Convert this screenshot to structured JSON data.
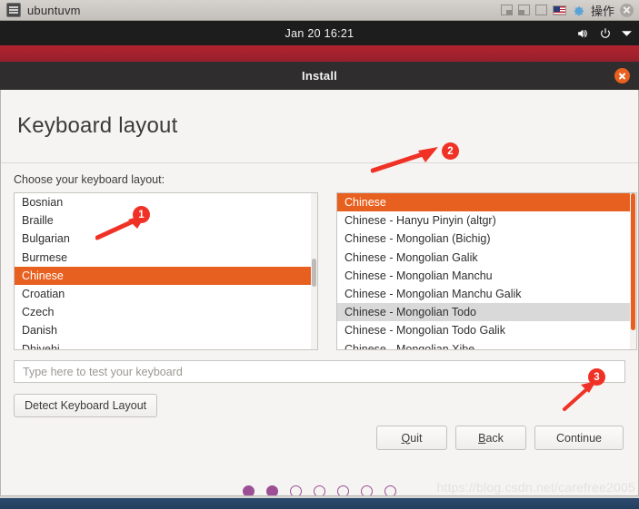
{
  "vm_window": {
    "title": "ubuntuvm",
    "app_icon": "terminal-icon",
    "controls": {
      "minimize": "minimize-icon",
      "restore": "restore-icon",
      "maximize": "maximize-icon",
      "keyboard_flag": "us-flag-icon",
      "settings": "gear-icon",
      "action_label": "操作",
      "close": "close-icon"
    }
  },
  "ubuntu_panel": {
    "clock": "Jan 20  16:21",
    "volume_icon": "volume-icon",
    "power_icon": "power-icon",
    "menu_icon": "chevron-down-icon"
  },
  "dialog": {
    "title": "Install",
    "close_icon": "close-icon"
  },
  "page": {
    "heading": "Keyboard layout",
    "prompt": "Choose your keyboard layout:"
  },
  "left_list": {
    "name": "keyboard-language-list",
    "items": [
      {
        "label": "Bosnian",
        "state": "normal"
      },
      {
        "label": "Braille",
        "state": "normal"
      },
      {
        "label": "Bulgarian",
        "state": "normal"
      },
      {
        "label": "Burmese",
        "state": "normal"
      },
      {
        "label": "Chinese",
        "state": "selected"
      },
      {
        "label": "Croatian",
        "state": "normal"
      },
      {
        "label": "Czech",
        "state": "normal"
      },
      {
        "label": "Danish",
        "state": "normal"
      },
      {
        "label": "Dhivehi",
        "state": "normal"
      }
    ],
    "scroll_thumb_top_pct": 42,
    "scroll_thumb_height_pct": 18
  },
  "right_list": {
    "name": "keyboard-variant-list",
    "items": [
      {
        "label": "Chinese",
        "state": "selected"
      },
      {
        "label": "Chinese - Hanyu Pinyin (altgr)",
        "state": "normal"
      },
      {
        "label": "Chinese - Mongolian (Bichig)",
        "state": "normal"
      },
      {
        "label": "Chinese - Mongolian Galik",
        "state": "normal"
      },
      {
        "label": "Chinese - Mongolian Manchu",
        "state": "normal"
      },
      {
        "label": "Chinese - Mongolian Manchu Galik",
        "state": "normal"
      },
      {
        "label": "Chinese - Mongolian Todo",
        "state": "hover"
      },
      {
        "label": "Chinese - Mongolian Todo Galik",
        "state": "normal"
      },
      {
        "label": "Chinese - Mongolian Xibe",
        "state": "normal"
      }
    ],
    "scroll_thumb_top_pct": 0,
    "scroll_thumb_height_pct": 88
  },
  "test_field": {
    "placeholder": "Type here to test your keyboard",
    "value": ""
  },
  "buttons": {
    "detect": "Detect Keyboard Layout",
    "quit": "Quit",
    "quit_mnemonic": "Q",
    "quit_rest": "uit",
    "back": "Back",
    "back_mnemonic": "B",
    "back_rest": "ack",
    "continue": "Continue"
  },
  "progress_dots": {
    "total": 7,
    "filled": 2,
    "color": "#9c4f95"
  },
  "annotations": [
    {
      "id": "1",
      "label": "1",
      "target": "left-list-chinese"
    },
    {
      "id": "2",
      "label": "2",
      "target": "right-list-chinese"
    },
    {
      "id": "3",
      "label": "3",
      "target": "continue-button"
    }
  ],
  "watermark": "https://blog.csdn.net/carefree2005",
  "colors": {
    "ubuntu_orange": "#e8601f",
    "panel_dark": "#1d1d1d",
    "dialog_header": "#2f2d2d",
    "desktop_maroon": "#a7212d",
    "annotation_red": "#f03226",
    "dot_purple": "#9c4f95"
  }
}
